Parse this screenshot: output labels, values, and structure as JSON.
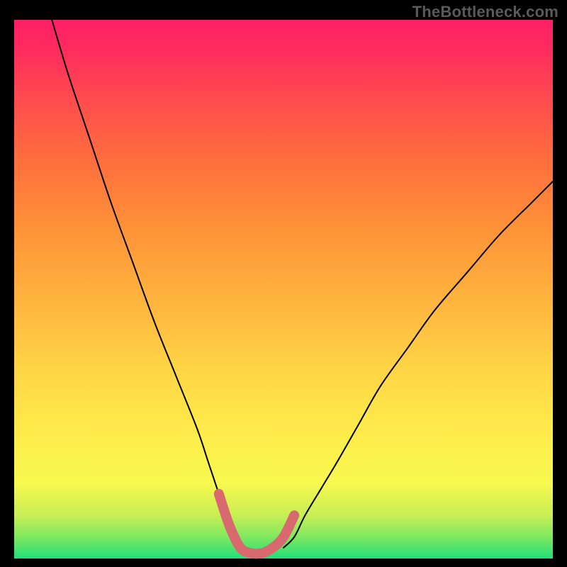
{
  "watermark": "TheBottleneck.com",
  "colors": {
    "background": "#000000",
    "curve": "#000000",
    "valley_highlight": "#d86a6f",
    "gradient_top": "#ff1f66",
    "gradient_mid_upper": "#ff9038",
    "gradient_mid": "#ffe94a",
    "gradient_mid_lower": "#c8ee55",
    "gradient_bottom": "#20e07a",
    "watermark_text": "#5a5a5a"
  },
  "chart_data": {
    "type": "line",
    "title": "",
    "xlabel": "",
    "ylabel": "",
    "xlim": [
      0,
      100
    ],
    "ylim": [
      0,
      100
    ],
    "grid": false,
    "legend": false,
    "series": [
      {
        "name": "bottleneck-curve-left",
        "x": [
          7,
          10,
          14,
          18,
          22,
          26,
          30,
          34,
          36,
          38,
          40,
          41,
          42
        ],
        "y": [
          100,
          90,
          78,
          66,
          55,
          44,
          34,
          24,
          18,
          12,
          6,
          4,
          2
        ]
      },
      {
        "name": "bottleneck-curve-right",
        "x": [
          50,
          52,
          54,
          57,
          60,
          64,
          68,
          73,
          78,
          84,
          90,
          96,
          100
        ],
        "y": [
          2,
          4,
          8,
          13,
          18,
          25,
          32,
          39,
          46,
          53,
          60,
          66,
          70
        ]
      },
      {
        "name": "valley-highlight",
        "x": [
          38,
          40,
          42,
          44,
          46,
          48,
          50,
          52
        ],
        "y": [
          12,
          6,
          2,
          1,
          1,
          2,
          4,
          8
        ]
      }
    ]
  }
}
